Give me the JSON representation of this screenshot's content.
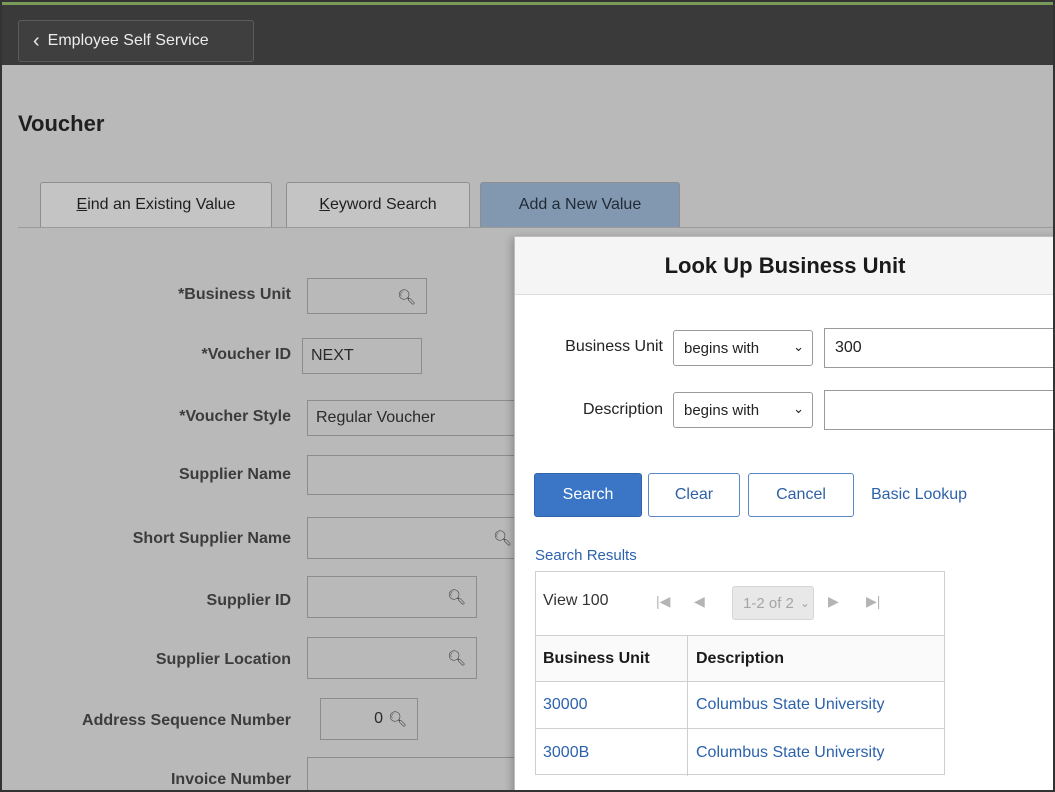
{
  "header": {
    "back_label": "Employee Self Service"
  },
  "page": {
    "title": "Voucher"
  },
  "tabs": [
    {
      "label_first": "E",
      "label_rest": "ind an Existing Value"
    },
    {
      "label_first": "K",
      "label_rest": "eyword Search"
    },
    {
      "label": "Add a New Value"
    }
  ],
  "form": {
    "business_unit": {
      "label": "*Business Unit",
      "value": ""
    },
    "voucher_id": {
      "label": "*Voucher ID",
      "value": "NEXT"
    },
    "voucher_style": {
      "label": "*Voucher Style",
      "value": "Regular Voucher"
    },
    "supplier_name": {
      "label": "Supplier Name",
      "value": ""
    },
    "short_supplier_name": {
      "label": "Short Supplier Name",
      "value": ""
    },
    "supplier_id": {
      "label": "Supplier ID",
      "value": ""
    },
    "supplier_location": {
      "label": "Supplier Location",
      "value": ""
    },
    "address_sequence_number": {
      "label": "Address Sequence Number",
      "value": "0"
    },
    "invoice_number": {
      "label": "Invoice Number",
      "value": ""
    }
  },
  "lookup": {
    "title": "Look Up Business Unit",
    "business_unit": {
      "label": "Business Unit",
      "operator": "begins with",
      "value": "300"
    },
    "description": {
      "label": "Description",
      "operator": "begins with",
      "value": ""
    },
    "buttons": {
      "search": "Search",
      "clear": "Clear",
      "cancel": "Cancel",
      "basic_lookup": "Basic Lookup"
    },
    "results": {
      "heading": "Search Results",
      "view": "View 100",
      "pager": "1-2 of 2",
      "columns": [
        "Business Unit",
        "Description"
      ],
      "rows": [
        {
          "business_unit": "30000",
          "description": "Columbus State University"
        },
        {
          "business_unit": "3000B",
          "description": "Columbus State University"
        }
      ]
    }
  }
}
